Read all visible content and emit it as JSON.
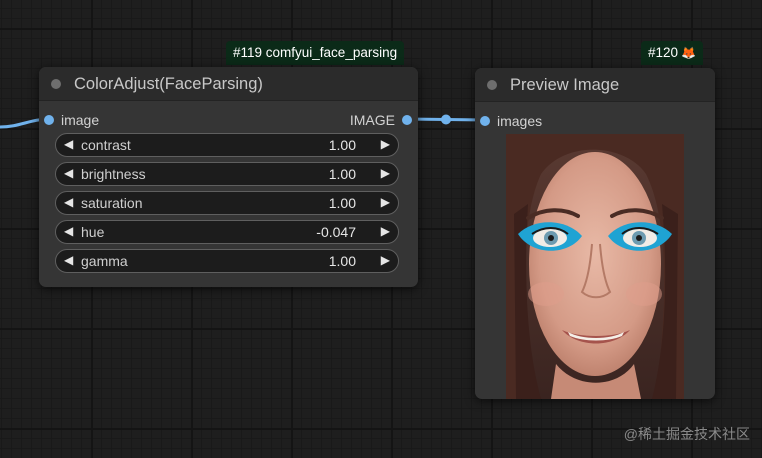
{
  "canvas": {
    "background": "#1e1e1e",
    "link_color": "#70b2ec"
  },
  "node_color_adjust": {
    "badge": "#119 comfyui_face_parsing",
    "title": "ColorAdjust(FaceParsing)",
    "input_label": "image",
    "output_label": "IMAGE",
    "widgets": [
      {
        "label": "contrast",
        "value": "1.00"
      },
      {
        "label": "brightness",
        "value": "1.00"
      },
      {
        "label": "saturation",
        "value": "1.00"
      },
      {
        "label": "hue",
        "value": "-0.047"
      },
      {
        "label": "gamma",
        "value": "1.00"
      }
    ],
    "arrow_left": "◀",
    "arrow_right": "▶"
  },
  "node_preview": {
    "badge": "#120",
    "badge_icon": "fox-icon",
    "badge_icon_glyph": "🦊",
    "title": "Preview Image",
    "input_label": "images",
    "image_subject": "portrait of smiling woman with blue eye makeup"
  },
  "watermark": "@稀土掘金技术社区"
}
